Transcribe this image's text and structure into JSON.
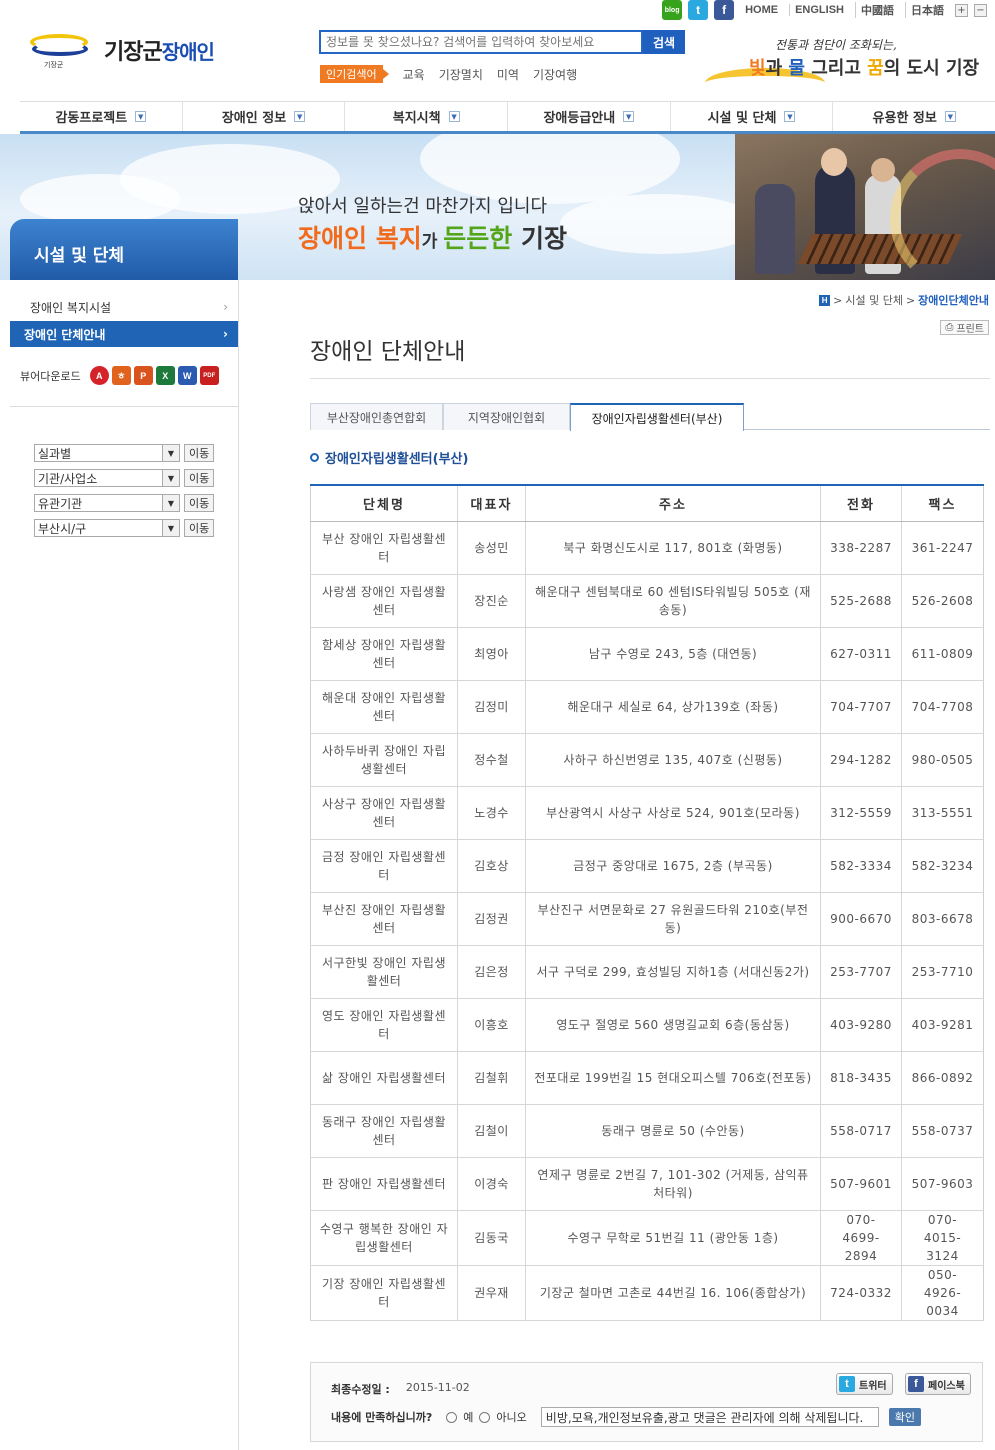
{
  "util": {
    "sns": [
      {
        "icon": "blog-icon",
        "glyph": "blog"
      },
      {
        "icon": "twitter-icon",
        "glyph": "t"
      },
      {
        "icon": "facebook-icon",
        "glyph": "f"
      }
    ],
    "links": [
      "HOME",
      "ENGLISH",
      "中國語",
      "日本語"
    ],
    "zoom_in": "+",
    "zoom_out": "−"
  },
  "logo": {
    "sub": "기장군",
    "name_main": "기장군",
    "name_sub": "장애인"
  },
  "search": {
    "placeholder": "정보를 못 찾으셨나요? 검색어를 입력하여 찾아보세요",
    "button": "검색",
    "popular_label": "인기검색어",
    "popular_words": [
      "교육",
      "기장멸치",
      "미역",
      "기장여행"
    ]
  },
  "slogan": {
    "line1": "전통과 첨단이 조화되는,",
    "w1": "빛",
    "t1": "과 ",
    "w2": "물",
    "t2": " 그리고 ",
    "w3": "꿈",
    "t3": "의 도시 기장"
  },
  "gnb": [
    "감동프로젝트",
    "장애인 정보",
    "복지시책",
    "장애등급안내",
    "시설 및 단체",
    "유용한 정보"
  ],
  "visual": {
    "copy1": "앉아서 일하는건 마찬가지 입니다",
    "copy2_a": "장애인 복지",
    "copy2_b": "가 ",
    "copy2_c": "든든한",
    "copy2_d": " 기장"
  },
  "lnb": {
    "title": "시설 및 단체",
    "items": [
      "장애인 복지시설",
      "장애인 단체안내"
    ],
    "viewer_label": "뷰어다운로드",
    "viewers": [
      {
        "icon": "acrobat-icon",
        "glyph": "A",
        "color": "#d4242a"
      },
      {
        "icon": "hangul-icon",
        "glyph": "ㅎ",
        "color": "#e0621d"
      },
      {
        "icon": "powerpoint-icon",
        "glyph": "P",
        "color": "#d9531e"
      },
      {
        "icon": "excel-icon",
        "glyph": "X",
        "color": "#1e7a3c"
      },
      {
        "icon": "word-icon",
        "glyph": "W",
        "color": "#2b5bb0"
      },
      {
        "icon": "pdf-icon",
        "glyph": "PDF",
        "color": "#c8201f"
      }
    ],
    "selects": [
      "실과별",
      "기관/사업소",
      "유관기관",
      "부산시/구"
    ],
    "go_label": "이동"
  },
  "location": {
    "home": "H",
    "path": [
      "시설 및 단체",
      "장애인단체안내"
    ]
  },
  "print_label": "프린트",
  "page_title": "장애인 단체안내",
  "tabs": [
    "부산장애인총연합회",
    "지역장애인협회",
    "장애인자립생활센터(부산)"
  ],
  "subhead": "장애인자립생활센터(부산)",
  "table": {
    "headers": [
      "단체명",
      "대표자",
      "주소",
      "전화",
      "팩스"
    ],
    "rows": [
      [
        "부산 장애인 자립생활센터",
        "송성민",
        "북구 화명신도시로 117, 801호 (화명동)",
        "338-2287",
        "361-2247"
      ],
      [
        "사랑샘 장애인 자립생활센터",
        "장진순",
        "해운대구 센텀북대로 60 센텀IS타워빌딩 505호 (재송동)",
        "525-2688",
        "526-2608"
      ],
      [
        "함세상 장애인 자립생활센터",
        "최영아",
        "남구 수영로 243, 5층 (대연동)",
        "627-0311",
        "611-0809"
      ],
      [
        "해운대 장애인 자립생활센터",
        "김정미",
        "해운대구 세실로 64, 상가139호 (좌동)",
        "704-7707",
        "704-7708"
      ],
      [
        "사하두바퀴 장애인 자립생활센터",
        "정수철",
        "사하구 하신번영로 135, 407호 (신평동)",
        "294-1282",
        "980-0505"
      ],
      [
        "사상구 장애인 자립생활센터",
        "노경수",
        "부산광역시 사상구 사상로 524, 901호(모라동)",
        "312-5559",
        "313-5551"
      ],
      [
        "금정 장애인 자립생활센터",
        "김호상",
        "금정구 중앙대로 1675, 2층 (부곡동)",
        "582-3334",
        "582-3234"
      ],
      [
        "부산진 장애인 자립생활센터",
        "김정권",
        "부산진구 서면문화로 27 유원골드타워 210호(부전동)",
        "900-6670",
        "803-6678"
      ],
      [
        "서구한빛 장애인 자립생활센터",
        "김은정",
        "서구 구덕로 299, 효성빌딩 지하1층 (서대신동2가)",
        "253-7707",
        "253-7710"
      ],
      [
        "영도 장애인 자립생활센터",
        "이흥호",
        "영도구 절영로 560 생명길교회 6층(동삼동)",
        "403-9280",
        "403-9281"
      ],
      [
        "삶 장애인 자립생활센터",
        "김철휘",
        "전포대로 199번길 15 현대오피스텔 706호(전포동)",
        "818-3435",
        "866-0892"
      ],
      [
        "동래구 장애인 자립생활센터",
        "김철이",
        "동래구 명륜로 50 (수안동)",
        "558-0717",
        "558-0737"
      ],
      [
        "판 장애인 자립생활센터",
        "이경숙",
        "연제구 명륜로 2번길 7, 101-302 (거제동, 삼익퓨처타워)",
        "507-9601",
        "507-9603"
      ],
      [
        "수영구 행복한 장애인 자립생활센터",
        "김동국",
        "수영구 무학로 51번길 11 (광안동 1층)",
        "070-4699-2894",
        "070-4015-3124"
      ],
      [
        "기장 장애인 자립생활센터",
        "권우재",
        "기장군 철마면 고촌로 44번길 16. 106(종합상가)",
        "724-0332",
        "050-4926-0034"
      ]
    ]
  },
  "feedback": {
    "updated_label": "최종수정일 :",
    "updated_date": "2015-11-02",
    "twitter_label": "트위터",
    "facebook_label": "페이스북",
    "question": "내용에 만족하십니까?",
    "yes": "예",
    "no": "아니오",
    "comment_value": "비방,모욕,개인정보유출,광고 댓글은 관리자에 의해 삭제됩니다.",
    "confirm": "확인"
  }
}
